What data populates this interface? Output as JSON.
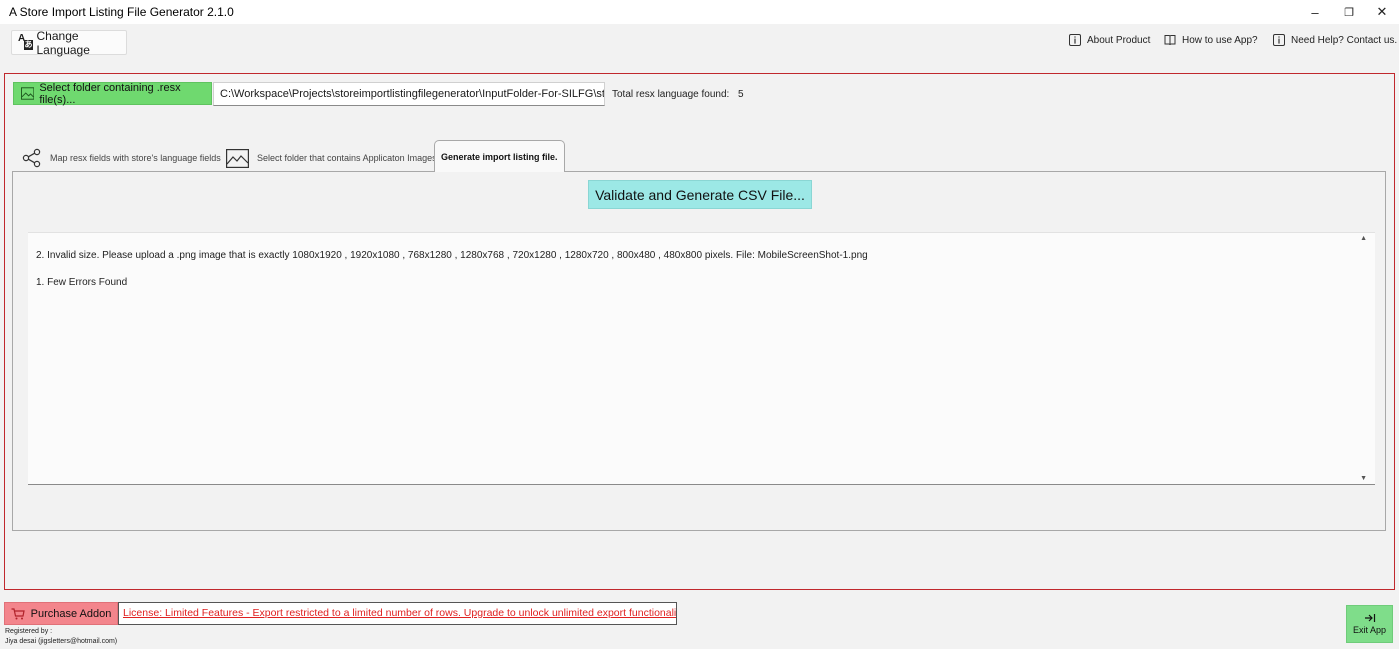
{
  "window": {
    "title": "A Store Import Listing File Generator 2.1.0",
    "minimize_glyph": "–",
    "restore_glyph": "❐",
    "close_glyph": "✕"
  },
  "header": {
    "change_language_label": "Change Language",
    "links": [
      {
        "label": "About Product",
        "icon": "info-icon"
      },
      {
        "label": "How to use App?",
        "icon": "book-icon"
      },
      {
        "label": "Need Help? Contact us.",
        "icon": "info-icon"
      }
    ]
  },
  "folder": {
    "select_button_label": "Select folder containing .resx file(s)...",
    "path": "C:\\Workspace\\Projects\\storeimportlistingfilegenerator\\InputFolder-For-SILFG\\strings",
    "resx_found_label": "Total resx language found:",
    "resx_found_count": "5"
  },
  "tabs": [
    {
      "label": "Map resx fields with store's language fields",
      "icon": "share-icon",
      "active": false
    },
    {
      "label": "Select folder that contains Applicaton Images",
      "icon": "image-icon",
      "active": false
    },
    {
      "label": "Generate import listing file.",
      "icon": "",
      "active": true
    }
  ],
  "generate": {
    "validate_button_label": "Validate and Generate CSV File...",
    "log_lines": [
      "2.  Invalid size. Please upload a .png image that is exactly 1080x1920 , 1920x1080 , 768x1280 , 1280x768 , 720x1280 , 1280x720 , 800x480 , 480x800 pixels.  File: MobileScreenShot-1.png",
      "1.  Few Errors Found"
    ]
  },
  "footer": {
    "purchase_label": "Purchase Addon",
    "license_text": "License: Limited Features - Export restricted to a limited number of rows. Upgrade to unlock unlimited export functionality.",
    "registered_by_label": "Registered by :",
    "registered_name": "Jiya desai (jigsletters@hotmail.com)",
    "exit_label": "Exit App"
  },
  "colors": {
    "panel_border": "#c0282d",
    "select_button": "#6fd96f",
    "validate_button": "#9ce8e6",
    "purchase_button": "#f3858c",
    "license_text": "#e02020",
    "exit_button": "#7fdd8a"
  }
}
